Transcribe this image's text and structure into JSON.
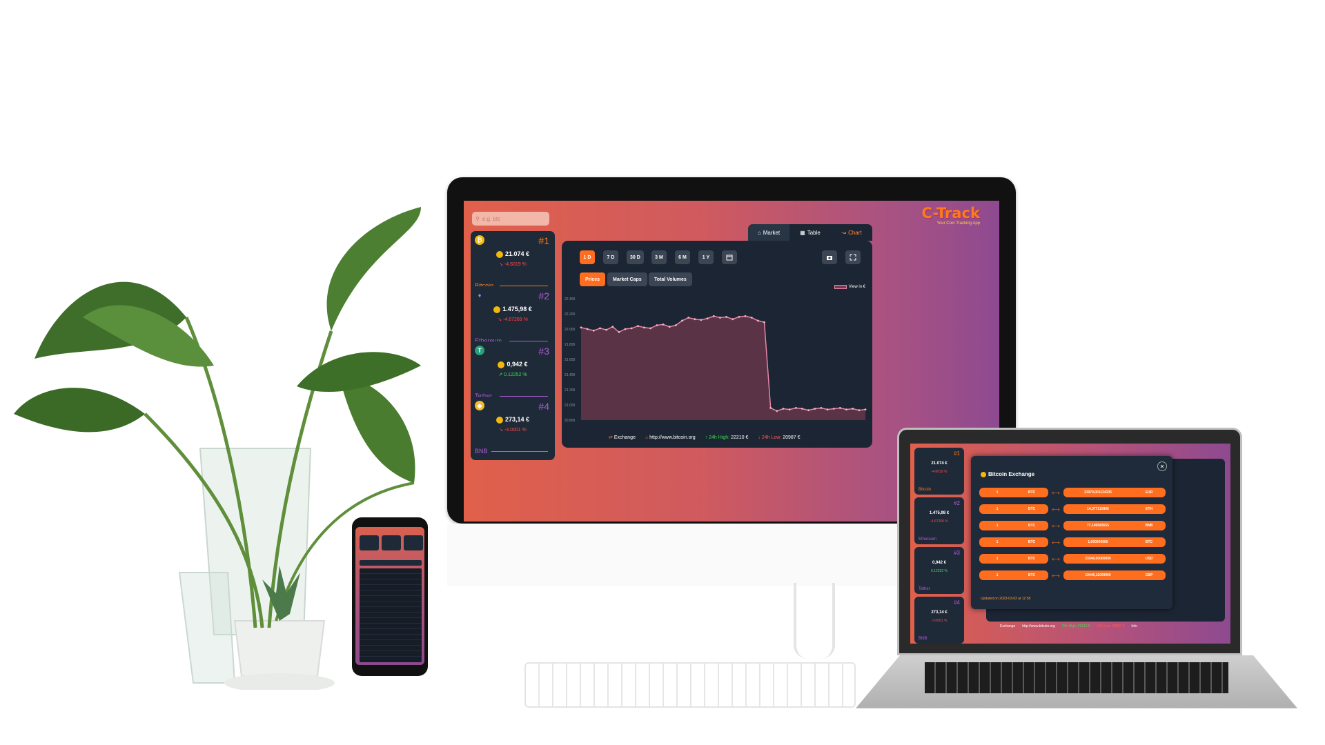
{
  "app": {
    "brand_title": "C-Track",
    "brand_subtitle": "Your Coin Tracking App",
    "search_placeholder": "e.g. btc"
  },
  "coins": [
    {
      "rank": "#1",
      "price": "21.074 €",
      "change": "-4.6019 %",
      "name": "Bitcoin",
      "trend": "down",
      "color": "#f2b90c",
      "rank_color": "#ff7a18"
    },
    {
      "rank": "#2",
      "price": "1.475,98 €",
      "change": "-4.67269 %",
      "name": "Ethereum",
      "trend": "down",
      "color": "#8c8cf5",
      "rank_color": "#b05ad8"
    },
    {
      "rank": "#3",
      "price": "0,942 €",
      "change": "0.12252 %",
      "name": "Tether",
      "trend": "up",
      "color": "#26a17b",
      "rank_color": "#b05ad8"
    },
    {
      "rank": "#4",
      "price": "273,14 €",
      "change": "-3.0001 %",
      "name": "BNB",
      "trend": "down",
      "color": "#f3ba2f",
      "rank_color": "#b05ad8"
    }
  ],
  "tabs": [
    {
      "label": "Market",
      "icon": "home-icon"
    },
    {
      "label": "Table",
      "icon": "table-icon"
    },
    {
      "label": "Chart",
      "icon": "chart-icon"
    }
  ],
  "range_buttons": [
    "1 D",
    "7 D",
    "30 D",
    "3 M",
    "6 M",
    "1 Y"
  ],
  "type_buttons": [
    "Prices",
    "Market Caps",
    "Total Volumes"
  ],
  "legend_label": "View in €",
  "footer": {
    "exchange": "Exchange",
    "website": "http://www.bitcoin.org",
    "high_label": "24h High:",
    "high_value": "22210 €",
    "low_label": "24h Low:",
    "low_value": "20987 €",
    "info": "Info"
  },
  "chart_data": {
    "type": "line",
    "series": [
      {
        "name": "View in €",
        "values": [
          22020,
          22000,
          21980,
          22010,
          21990,
          22030,
          21960,
          22000,
          22010,
          22040,
          22020,
          22010,
          22050,
          22060,
          22030,
          22050,
          22110,
          22150,
          22130,
          22120,
          22140,
          22170,
          22150,
          22160,
          22130,
          22160,
          22170,
          22150,
          22110,
          22090,
          20960,
          20920,
          20950,
          20940,
          20960,
          20950,
          20930,
          20950,
          20960,
          20940,
          20950,
          20960,
          20940,
          20950,
          20930,
          20940
        ]
      }
    ],
    "yticks": [
      "22.400",
      "22.200",
      "22.000",
      "21.800",
      "21.600",
      "21.400",
      "21.200",
      "21.000",
      "20.800"
    ],
    "ylim": [
      20800,
      22400
    ]
  },
  "laptop_modal": {
    "title": "Bitcoin Exchange",
    "rows": [
      {
        "from_val": "1",
        "from_cur": "BTC",
        "to_val": "21970,001124335",
        "to_cur": "EUR"
      },
      {
        "from_val": "1",
        "from_cur": "BTC",
        "to_val": "14,377115805",
        "to_cur": "ETH"
      },
      {
        "from_val": "1",
        "from_cur": "BTC",
        "to_val": "77,106583555",
        "to_cur": "BNB"
      },
      {
        "from_val": "1",
        "from_cur": "BTC",
        "to_val": "1,000000000",
        "to_cur": "BTC"
      },
      {
        "from_val": "1",
        "from_cur": "BTC",
        "to_val": "23346,00000000",
        "to_cur": "USD"
      },
      {
        "from_val": "1",
        "from_cur": "BTC",
        "to_val": "19446,11000000",
        "to_cur": "GBP"
      }
    ],
    "updated": "Updated on 2023-03-03 at 12:58"
  },
  "laptop_coins": [
    {
      "rank": "#1",
      "price": "21.074 €",
      "change": "-4.6019 %",
      "name": "Bitcoin"
    },
    {
      "rank": "#2",
      "price": "1.475,98 €",
      "change": "-4.67269 %",
      "name": "Ethereum"
    },
    {
      "rank": "#3",
      "price": "0,942 €",
      "change": "0.12252 %",
      "name": "Tether"
    },
    {
      "rank": "#4",
      "price": "273,14 €",
      "change": "-3.0001 %",
      "name": "BNB"
    }
  ],
  "laptop_footer": {
    "exchange": "Exchange",
    "website": "http://www.bitcoin.org",
    "high": "24h High: 22210 €",
    "low": "24h Low: 20987 €",
    "info": "Info"
  },
  "colors": {
    "accent": "#ff6d1f",
    "panel": "#1c2533",
    "card": "#1f2a38",
    "up": "#3ddc56",
    "down": "#ff4a4a",
    "line": "#e788a7"
  }
}
